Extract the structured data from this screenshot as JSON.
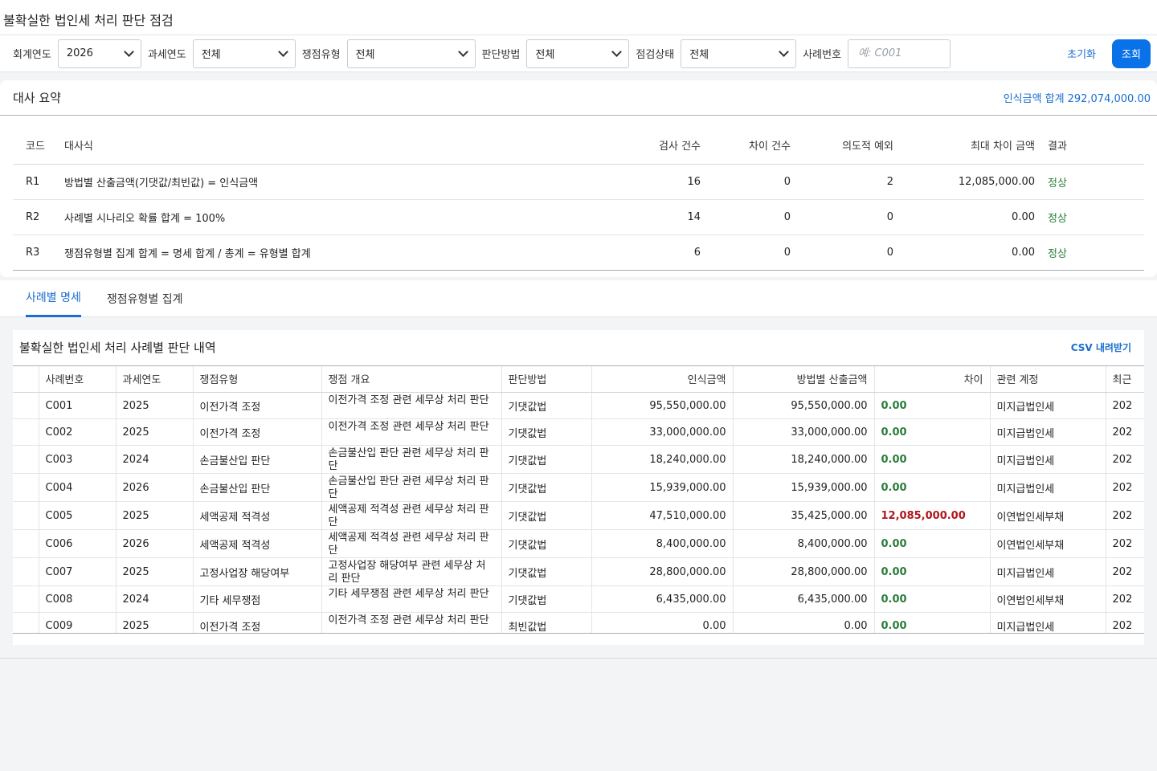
{
  "page": {
    "title": "불확실한 법인세 처리 판단 점검"
  },
  "filters": {
    "fiscal_year": {
      "label": "회계연도",
      "value": "2026"
    },
    "tax_year": {
      "label": "과세연도",
      "value": "전체"
    },
    "issue_type": {
      "label": "쟁점유형",
      "value": "전체"
    },
    "method": {
      "label": "판단방법",
      "value": "전체"
    },
    "status": {
      "label": "점검상태",
      "value": "전체"
    },
    "case_no": {
      "label": "사례번호",
      "placeholder": "예: C001"
    },
    "reset_label": "초기화",
    "search_label": "조회"
  },
  "summary": {
    "title": "대사 요약",
    "total_label": "인식금액 합계",
    "total_value": "292,074,000.00",
    "columns": [
      "코드",
      "대사식",
      "검사 건수",
      "차이 건수",
      "의도적 예외",
      "최대 차이 금액",
      "결과"
    ],
    "rows": [
      {
        "code": "R1",
        "formula": "방법별 산출금액(기댓값/최빈값) = 인식금액",
        "checks": "16",
        "diffs": "0",
        "exceptions": "2",
        "max_diff": "12,085,000.00",
        "result": "정상"
      },
      {
        "code": "R2",
        "formula": "사례별 시나리오 확률 합계 = 100%",
        "checks": "14",
        "diffs": "0",
        "exceptions": "0",
        "max_diff": "0.00",
        "result": "정상"
      },
      {
        "code": "R3",
        "formula": "쟁점유형별 집계 합계 = 명세 합계 / 총계 = 유형별 합계",
        "checks": "6",
        "diffs": "0",
        "exceptions": "0",
        "max_diff": "0.00",
        "result": "정상"
      }
    ]
  },
  "tabs": [
    {
      "label": "사례별 명세",
      "active": true
    },
    {
      "label": "쟁점유형별 집계",
      "active": false
    }
  ],
  "detail": {
    "title": "불확실한 법인세 처리 사례별 판단 내역",
    "csv_label": "CSV 내려받기",
    "columns": [
      "사례번호",
      "과세연도",
      "쟁점유형",
      "쟁점 개요",
      "판단방법",
      "인식금액",
      "방법별 산출금액",
      "차이",
      "관련 계정",
      "최근"
    ],
    "rows": [
      {
        "case": "C001",
        "year": "2025",
        "type": "이전가격 조정",
        "summary": "이전가격 조정 관련 세무상 처리 판단",
        "method": "기댓값법",
        "recognized": "95,550,000.00",
        "computed": "95,550,000.00",
        "diff": "0.00",
        "account": "미지급법인세",
        "recent": "202"
      },
      {
        "case": "C002",
        "year": "2025",
        "type": "이전가격 조정",
        "summary": "이전가격 조정 관련 세무상 처리 판단",
        "method": "기댓값법",
        "recognized": "33,000,000.00",
        "computed": "33,000,000.00",
        "diff": "0.00",
        "account": "미지급법인세",
        "recent": "202"
      },
      {
        "case": "C003",
        "year": "2024",
        "type": "손금불산입 판단",
        "summary": "손금불산입 판단 관련 세무상 처리 판단",
        "method": "기댓값법",
        "recognized": "18,240,000.00",
        "computed": "18,240,000.00",
        "diff": "0.00",
        "account": "미지급법인세",
        "recent": "202"
      },
      {
        "case": "C004",
        "year": "2026",
        "type": "손금불산입 판단",
        "summary": "손금불산입 판단 관련 세무상 처리 판단",
        "method": "기댓값법",
        "recognized": "15,939,000.00",
        "computed": "15,939,000.00",
        "diff": "0.00",
        "account": "미지급법인세",
        "recent": "202"
      },
      {
        "case": "C005",
        "year": "2025",
        "type": "세액공제 적격성",
        "summary": "세액공제 적격성 관련 세무상 처리 판단",
        "method": "기댓값법",
        "recognized": "47,510,000.00",
        "computed": "35,425,000.00",
        "diff": "12,085,000.00",
        "account": "이연법인세부채",
        "recent": "202"
      },
      {
        "case": "C006",
        "year": "2026",
        "type": "세액공제 적격성",
        "summary": "세액공제 적격성 관련 세무상 처리 판단",
        "method": "기댓값법",
        "recognized": "8,400,000.00",
        "computed": "8,400,000.00",
        "diff": "0.00",
        "account": "이연법인세부채",
        "recent": "202"
      },
      {
        "case": "C007",
        "year": "2025",
        "type": "고정사업장 해당여부",
        "summary": "고정사업장 해당여부 관련 세무상 처리 판단",
        "method": "기댓값법",
        "recognized": "28,800,000.00",
        "computed": "28,800,000.00",
        "diff": "0.00",
        "account": "미지급법인세",
        "recent": "202"
      },
      {
        "case": "C008",
        "year": "2024",
        "type": "기타 세무쟁점",
        "summary": "기타 세무쟁점 관련 세무상 처리 판단",
        "method": "기댓값법",
        "recognized": "6,435,000.00",
        "computed": "6,435,000.00",
        "diff": "0.00",
        "account": "이연법인세부채",
        "recent": "202"
      },
      {
        "case": "C009",
        "year": "2025",
        "type": "이전가격 조정",
        "summary": "이전가격 조정 관련 세무상 처리 판단",
        "method": "최빈값법",
        "recognized": "0.00",
        "computed": "0.00",
        "diff": "0.00",
        "account": "미지급법인세",
        "recent": "202"
      }
    ]
  },
  "colors": {
    "accent": "#1a6dd1",
    "primary_button": "#0a72e8",
    "ok": "#2a7d3a",
    "diff_positive": "#b0161d"
  }
}
